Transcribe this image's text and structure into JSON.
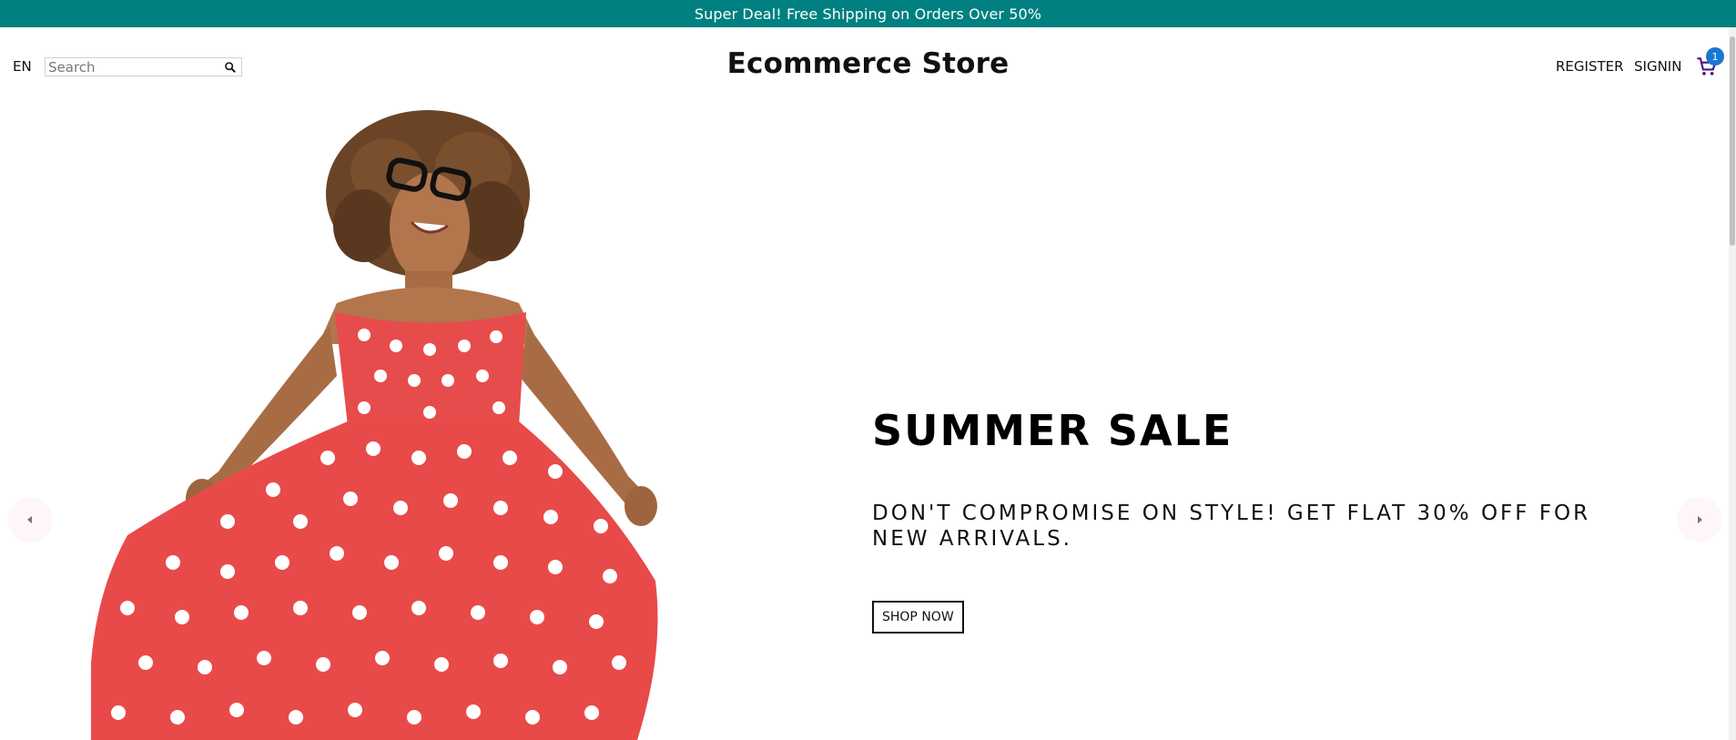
{
  "announcement": {
    "text": "Super Deal! Free Shipping on Orders Over 50%",
    "background_color": "#008080"
  },
  "navbar": {
    "language": "EN",
    "search": {
      "placeholder": "Search",
      "value": "",
      "icon": "search-icon"
    },
    "brand": "Ecommerce Store",
    "links": {
      "register": "REGISTER",
      "signin": "SIGNIN"
    },
    "cart": {
      "icon": "shopping-cart-icon",
      "badge_count": "1",
      "badge_color": "#1976d2",
      "icon_color": "#4a148c"
    }
  },
  "slider": {
    "slide": {
      "image": "woman-in-red-polka-dot-dress",
      "title": "SUMMER SALE",
      "description": "DON'T COMPROMISE ON STYLE! GET FLAT 30% OFF FOR NEW ARRIVALS.",
      "button": "SHOP NOW"
    },
    "arrows": {
      "left": "arrow-left-icon",
      "right": "arrow-right-icon"
    }
  }
}
